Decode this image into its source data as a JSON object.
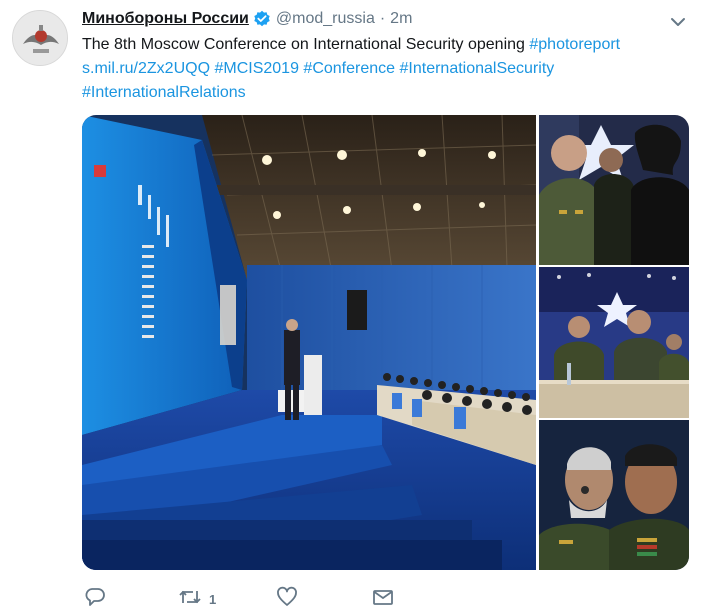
{
  "tweet": {
    "author_name": "Минобороны России",
    "handle": "@mod_russia",
    "separator": "·",
    "time": "2m",
    "text_plain": "The 8th Moscow Conference on International Security opening ",
    "links": [
      "#photoreport",
      "s.mil.ru/2Zx2UQQ",
      "#MCIS2019",
      "#Conference",
      "#InternationalSecurity",
      "#InternationalRelations"
    ],
    "retweet_count": "1"
  },
  "icons": {
    "verified": "verified-badge-icon",
    "caret": "chevron-down-icon",
    "reply": "reply-icon",
    "retweet": "retweet-icon",
    "like": "heart-icon",
    "dm": "envelope-icon"
  },
  "colors": {
    "link": "#1b95e0",
    "meta": "#657786",
    "verified": "#1da1f2"
  }
}
